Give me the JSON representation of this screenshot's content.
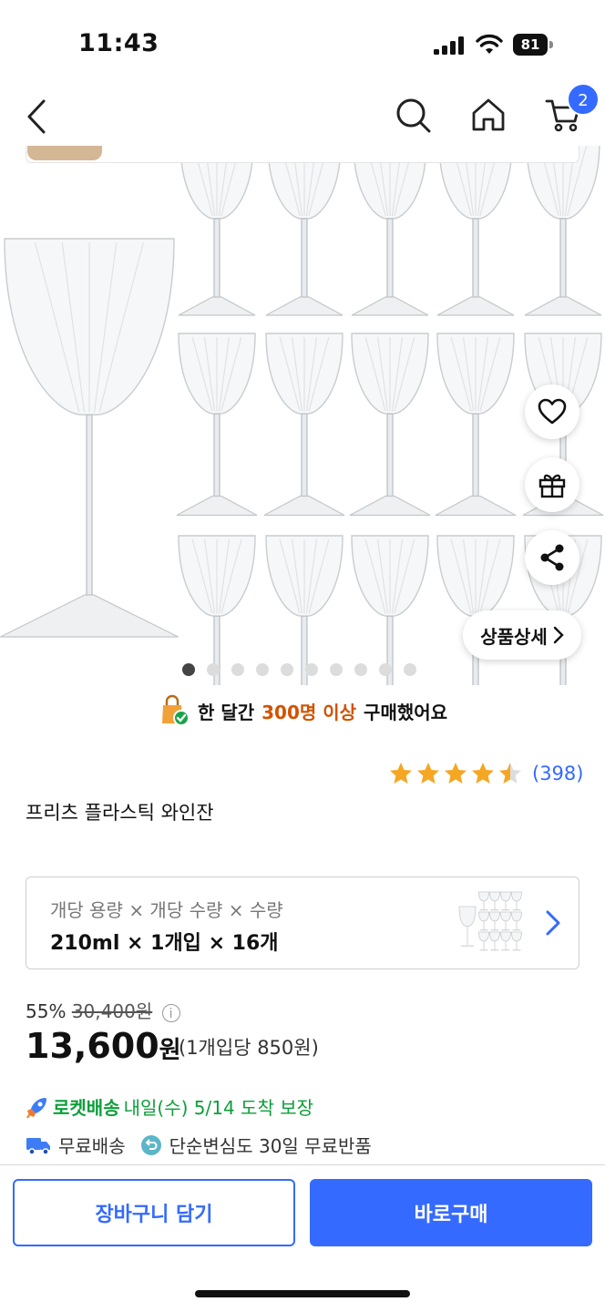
{
  "status_bar": {
    "time": "11:43",
    "battery": "81"
  },
  "nav": {
    "cart_count": "2"
  },
  "gallery": {
    "dot_count": 10,
    "active_index": 0,
    "detail_label": "상품상세"
  },
  "social_proof": {
    "prefix": "한 달간",
    "highlight": "300명 이상",
    "suffix": "구매했어요"
  },
  "rating": {
    "stars": 4.5,
    "count": "(398)"
  },
  "product": {
    "title": "프리츠 플라스틱 와인잔"
  },
  "option": {
    "label": "개당 용량 × 개당 수량 × 수량",
    "value": "210ml × 1개입 × 16개"
  },
  "price": {
    "discount": "55%",
    "original": "30,400원",
    "current": "13,600",
    "currency": "원",
    "unit_price": "(1개입당 850원)"
  },
  "delivery": {
    "rocket_label": "로켓배송",
    "eta": "내일(수) 5/14 도착 보장",
    "free_shipping": "무료배송",
    "returns": "단순변심도 30일 무료반품"
  },
  "actions": {
    "add_to_cart": "장바구니 담기",
    "buy_now": "바로구매"
  },
  "colors": {
    "accent": "#346aff",
    "rocket_green": "#0d9e3a",
    "highlight_orange": "#d15300",
    "star": "#f5a623"
  }
}
